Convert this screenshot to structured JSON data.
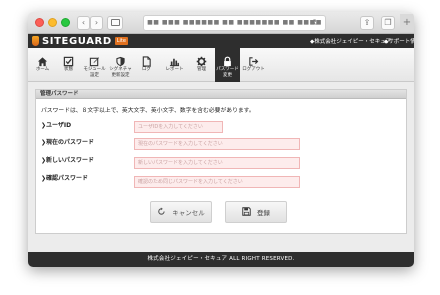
{
  "browser": {
    "url_text": "■■ ■■■ ■■■■■■ ■■ ■■■■■■■ ■■ ■■■■"
  },
  "app": {
    "logo_text": "SITEGUARD",
    "logo_badge": "Lite",
    "company": "◆株式会社ジェイピー・セキュア",
    "support": "◆サポート情報"
  },
  "nav": {
    "items": [
      {
        "label": "ホーム",
        "icon": "home-icon"
      },
      {
        "label": "状態",
        "icon": "checkbox-icon"
      },
      {
        "label": "モジュール\n設定",
        "icon": "edit-icon"
      },
      {
        "label": "シグネチャ\n更新設定",
        "icon": "shield-icon"
      },
      {
        "label": "ログ",
        "icon": "document-icon"
      },
      {
        "label": "レポート",
        "icon": "chart-icon"
      },
      {
        "label": "管理",
        "icon": "gear-icon"
      },
      {
        "label": "パスワード\n変更",
        "icon": "lock-icon"
      },
      {
        "label": "ログアウト",
        "icon": "logout-icon"
      }
    ]
  },
  "panel": {
    "title": "管理パスワード",
    "description": "パスワードは、８文字以上で、英大文字、英小文字、数字を含む必要があります。",
    "fields": [
      {
        "label": "ユーザID",
        "placeholder": "ユーザIDを入力してください"
      },
      {
        "label": "現在のパスワード",
        "placeholder": "現在のパスワードを入力してください"
      },
      {
        "label": "新しいパスワード",
        "placeholder": "新しいパスワードを入力してください"
      },
      {
        "label": "確認パスワード",
        "placeholder": "確認のため同じパスワードを入力してください"
      }
    ],
    "cancel_label": "キャンセル",
    "save_label": "登録"
  },
  "footer": {
    "text": "株式会社ジェイピー・セキュア ALL RIGHT RESERVED."
  },
  "colors": {
    "header_bg": "#2e2e2e",
    "accent": "#e0701e",
    "input_error_bg": "#fdecec",
    "input_error_border": "#f0b6b6"
  }
}
